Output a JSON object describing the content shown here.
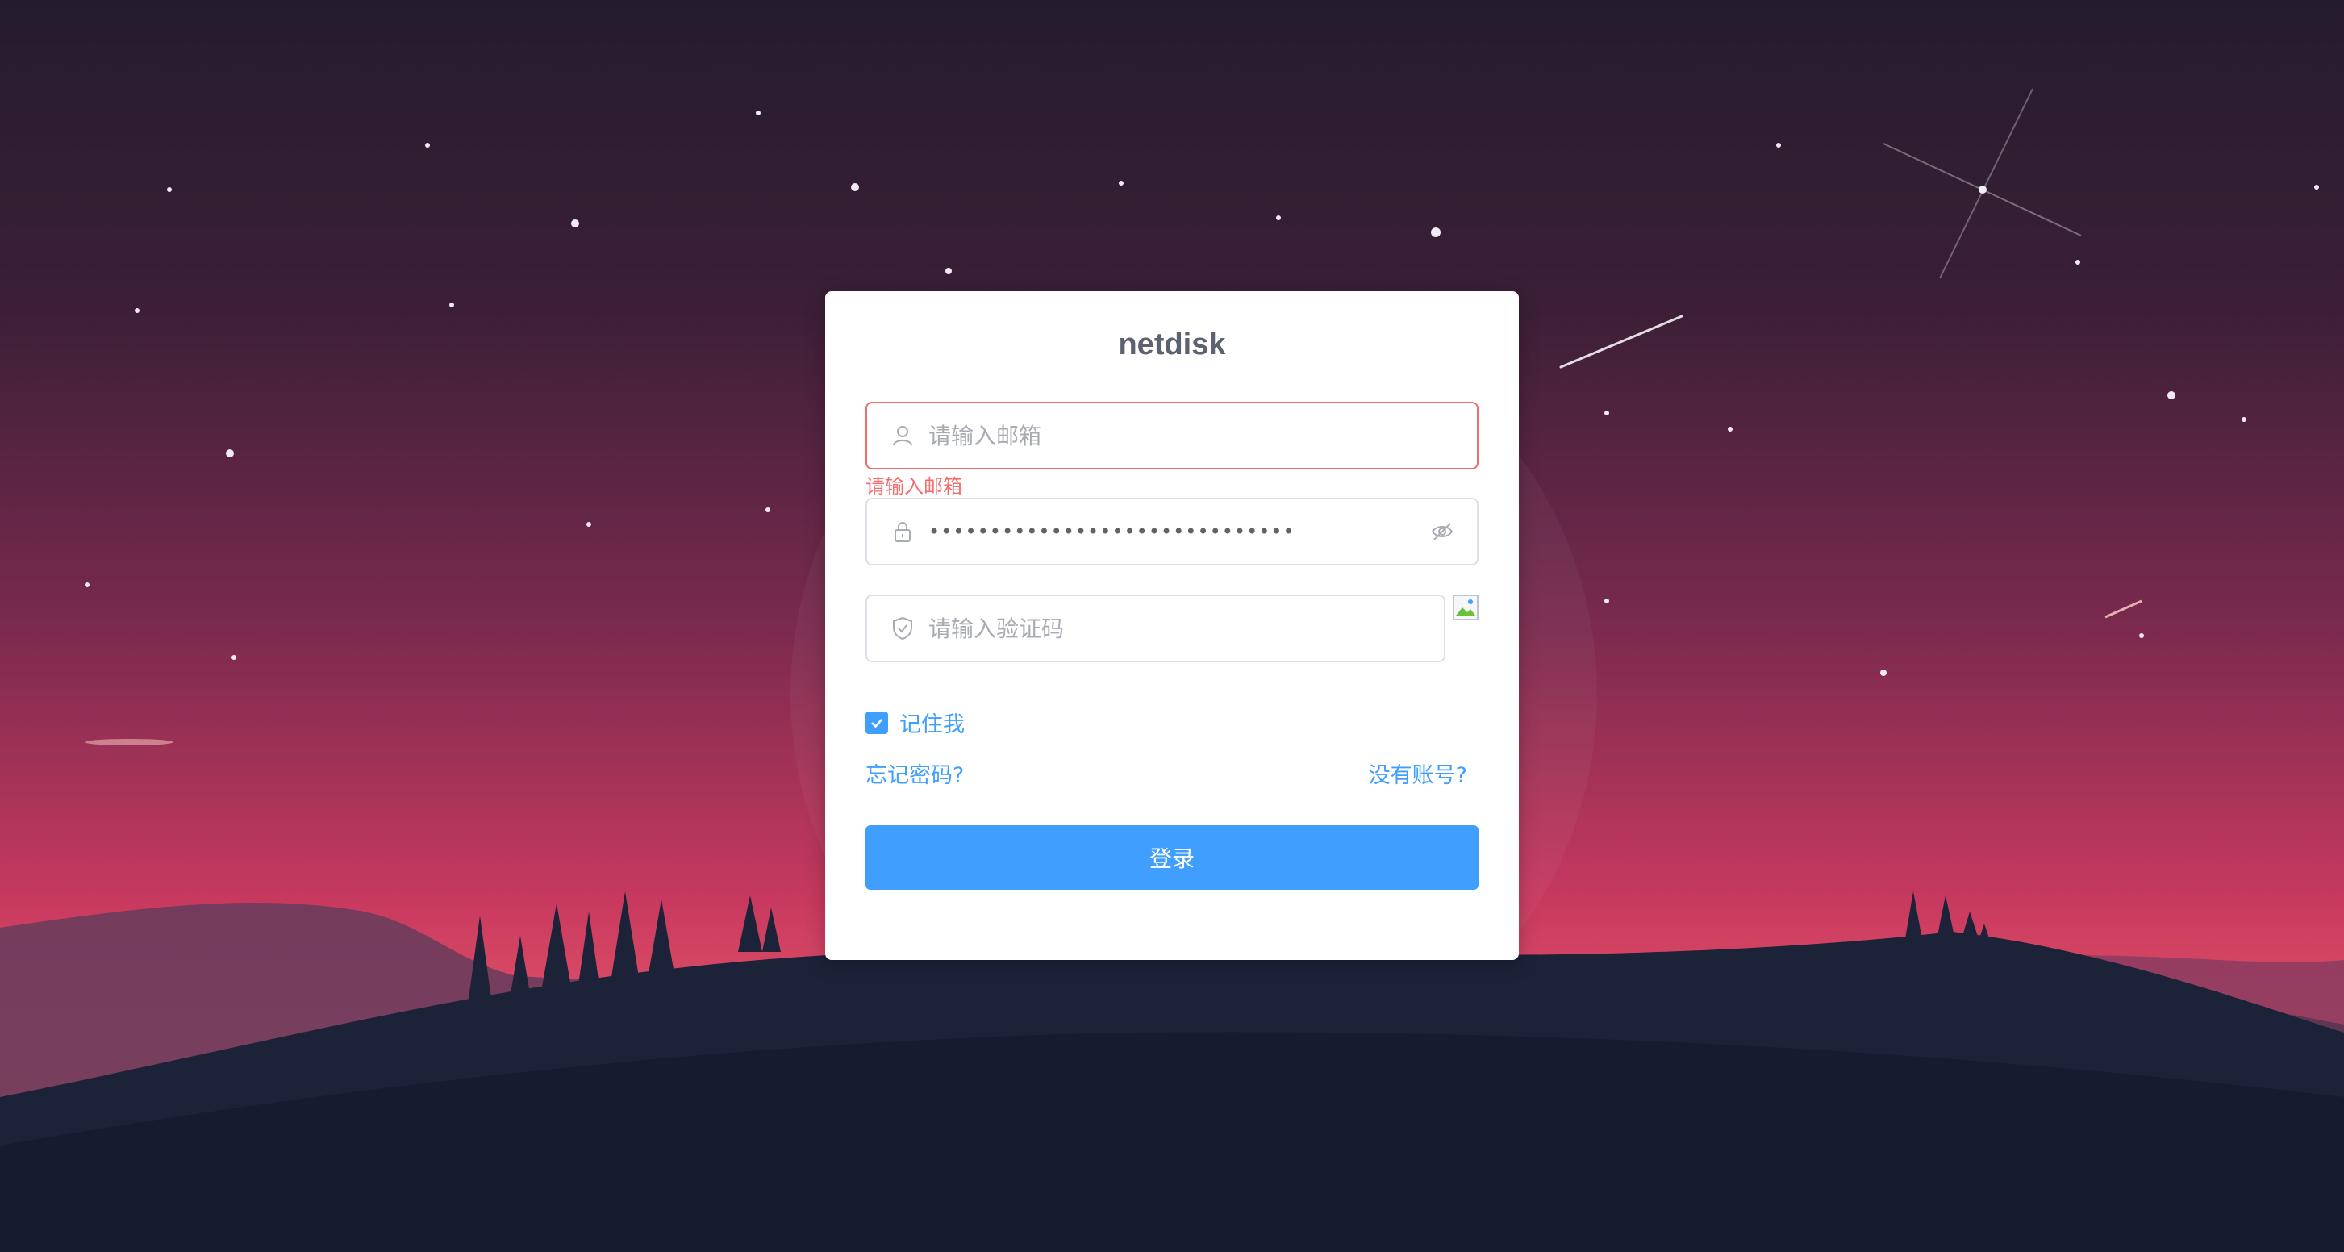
{
  "app": {
    "title": "netdisk"
  },
  "form": {
    "email": {
      "placeholder": "请输入邮箱",
      "value": "",
      "error": "请输入邮箱"
    },
    "password": {
      "value": "••••••••••••••••••••••••••••••"
    },
    "captcha": {
      "placeholder": "请输入验证码",
      "value": ""
    },
    "remember": {
      "label": "记住我",
      "checked": true
    },
    "forgot_link": "忘记密码?",
    "register_link": "没有账号?",
    "submit_label": "登录"
  },
  "icons": {
    "email": "user-icon",
    "password": "lock-icon",
    "toggle": "eye-off-icon",
    "captcha": "shield-icon",
    "checkbox": "check-icon"
  },
  "colors": {
    "primary": "#409eff",
    "error": "#f56c6c",
    "title": "#5b6270",
    "border": "#dcdfe6"
  }
}
